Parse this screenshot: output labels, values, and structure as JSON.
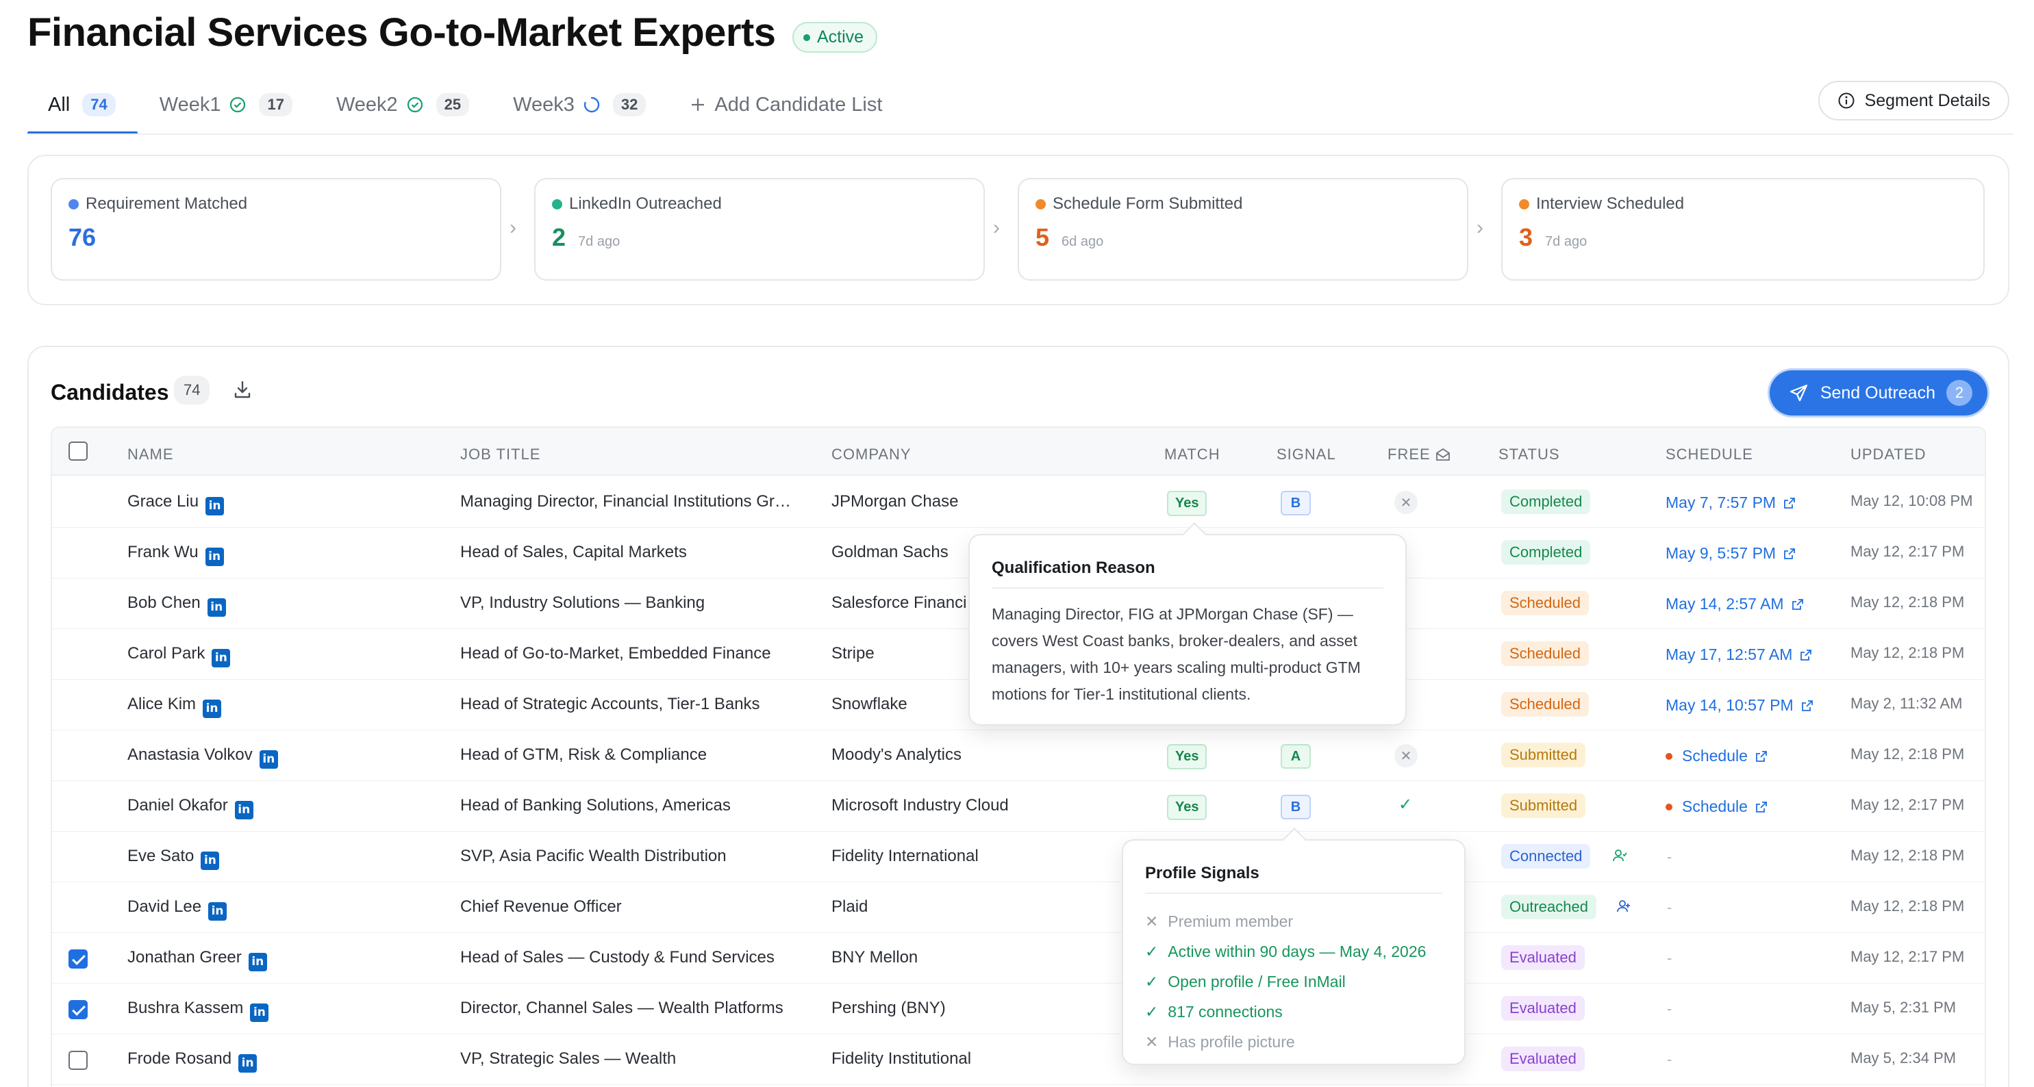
{
  "page": {
    "title": "Financial Services Go-to-Market Experts",
    "status": "Active"
  },
  "tabs": [
    {
      "label": "All",
      "count": "74"
    },
    {
      "label": "Week1",
      "count": "17"
    },
    {
      "label": "Week2",
      "count": "25"
    },
    {
      "label": "Week3",
      "count": "32"
    },
    {
      "label": "Add Candidate List"
    }
  ],
  "segment_details": "Segment Details",
  "funnel": [
    {
      "label": "Requirement Matched",
      "value": "76",
      "ago": "",
      "color": "#4f86f0"
    },
    {
      "label": "LinkedIn Outreached",
      "value": "2",
      "ago": "7d ago",
      "color": "#22b38a"
    },
    {
      "label": "Schedule Form Submitted",
      "value": "5",
      "ago": "6d ago",
      "color": "#f08a2a"
    },
    {
      "label": "Interview Scheduled",
      "value": "3",
      "ago": "7d ago",
      "color": "#f08a2a"
    }
  ],
  "candidates": {
    "title": "Candidates",
    "count": "74",
    "send_label": "Send Outreach",
    "send_count": "2",
    "columns": [
      "NAME",
      "JOB TITLE",
      "COMPANY",
      "MATCH",
      "SIGNAL",
      "FREE",
      "STATUS",
      "SCHEDULE",
      "UPDATED"
    ],
    "rows": [
      {
        "name": "Grace Liu",
        "title": "Managing Director, Financial Institutions Gr…",
        "company": "JPMorgan Chase",
        "match": "Yes",
        "signal": "B",
        "free": "x",
        "status": "Completed",
        "schedule": "May 7, 7:57 PM",
        "updated": "May 12, 10:08 PM",
        "checked": false
      },
      {
        "name": "Frank Wu",
        "title": "Head of Sales, Capital Markets",
        "company": "Goldman Sachs",
        "match": "",
        "signal": "",
        "free": "",
        "status": "Completed",
        "schedule": "May 9, 5:57 PM",
        "updated": "May 12, 2:17 PM",
        "checked": false
      },
      {
        "name": "Bob Chen",
        "title": "VP, Industry Solutions — Banking",
        "company": "Salesforce Financi",
        "match": "",
        "signal": "",
        "free": "",
        "status": "Scheduled",
        "schedule": "May 14, 2:57 AM",
        "updated": "May 12, 2:18 PM",
        "checked": false
      },
      {
        "name": "Carol Park",
        "title": "Head of Go-to-Market, Embedded Finance",
        "company": "Stripe",
        "match": "",
        "signal": "",
        "free": "",
        "status": "Scheduled",
        "schedule": "May 17, 12:57 AM",
        "updated": "May 12, 2:18 PM",
        "checked": false
      },
      {
        "name": "Alice Kim",
        "title": "Head of Strategic Accounts, Tier-1 Banks",
        "company": "Snowflake",
        "match": "",
        "signal": "",
        "free": "",
        "status": "Scheduled",
        "schedule": "May 14, 10:57 PM",
        "updated": "May 2, 11:32 AM",
        "checked": false
      },
      {
        "name": "Anastasia Volkov",
        "title": "Head of GTM, Risk & Compliance",
        "company": "Moody's Analytics",
        "match": "Yes",
        "signal": "A",
        "free": "x",
        "status": "Submitted",
        "schedule": "Schedule",
        "updated": "May 12, 2:18 PM",
        "checked": false
      },
      {
        "name": "Daniel Okafor",
        "title": "Head of Banking Solutions, Americas",
        "company": "Microsoft Industry Cloud",
        "match": "Yes",
        "signal": "B",
        "free": "ok",
        "status": "Submitted",
        "schedule": "Schedule",
        "updated": "May 12, 2:17 PM",
        "checked": false
      },
      {
        "name": "Eve Sato",
        "title": "SVP, Asia Pacific Wealth Distribution",
        "company": "Fidelity International",
        "match": "",
        "signal": "",
        "free": "",
        "status": "Connected",
        "schedule": "-",
        "updated": "May 12, 2:18 PM",
        "checked": false
      },
      {
        "name": "David Lee",
        "title": "Chief Revenue Officer",
        "company": "Plaid",
        "match": "",
        "signal": "",
        "free": "",
        "status": "Outreached",
        "schedule": "-",
        "updated": "May 12, 2:18 PM",
        "checked": false
      },
      {
        "name": "Jonathan Greer",
        "title": "Head of Sales — Custody & Fund Services",
        "company": "BNY Mellon",
        "match": "",
        "signal": "",
        "free": "",
        "status": "Evaluated",
        "schedule": "-",
        "updated": "May 12, 2:17 PM",
        "checked": true
      },
      {
        "name": "Bushra Kassem",
        "title": "Director, Channel Sales — Wealth Platforms",
        "company": "Pershing (BNY)",
        "match": "",
        "signal": "",
        "free": "",
        "status": "Evaluated",
        "schedule": "-",
        "updated": "May 5, 2:31 PM",
        "checked": true
      },
      {
        "name": "Frode Rosand",
        "title": "VP, Strategic Sales — Wealth",
        "company": "Fidelity Institutional",
        "match": "",
        "signal": "",
        "free": "",
        "status": "Evaluated",
        "schedule": "-",
        "updated": "May 5, 2:34 PM",
        "checked": false
      }
    ]
  },
  "qualification_popover": {
    "title": "Qualification Reason",
    "text": "Managing Director, FIG at JPMorgan Chase (SF) — covers West Coast banks, broker-dealers, and asset managers, with 10+ years scaling multi-product GTM motions for Tier-1 institutional clients."
  },
  "profile_popover": {
    "title": "Profile Signals",
    "items": [
      {
        "label": "Premium member",
        "ok": false
      },
      {
        "label": "Active within 90 days — May 4, 2026",
        "ok": true
      },
      {
        "label": "Open profile / Free InMail",
        "ok": true
      },
      {
        "label": "817 connections",
        "ok": true
      },
      {
        "label": "Has profile picture",
        "ok": false
      }
    ]
  }
}
